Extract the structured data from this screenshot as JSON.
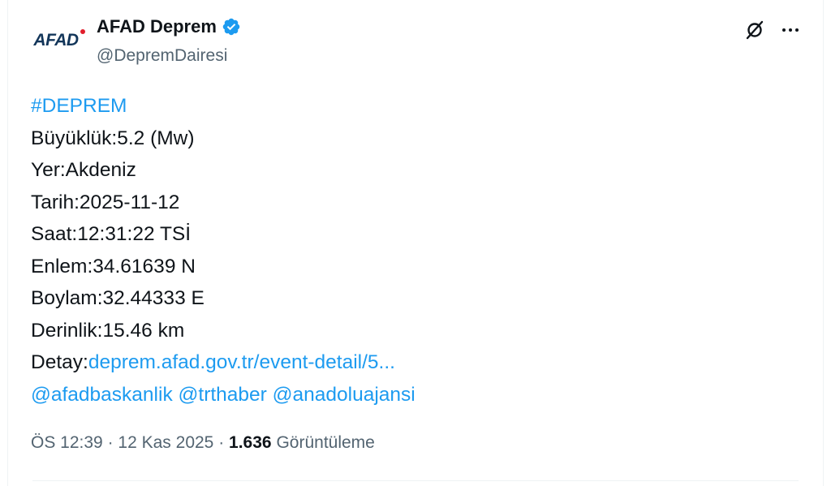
{
  "author": {
    "logo_text": "AFAD",
    "display_name": "AFAD Deprem",
    "handle": "@DepremDairesi",
    "verified_icon": "verified-badge-icon",
    "brand_colors": {
      "logo_blue": "#13365a",
      "logo_red": "#e11d2b",
      "verified_blue": "#1d9bf0"
    }
  },
  "actions": {
    "grok_icon": "grok-icon",
    "more_icon": "more-horizontal-icon",
    "more_label": "···"
  },
  "post": {
    "hashtag": "#DEPREM",
    "lines": [
      "Büyüklük:5.2 (Mw)",
      "Yer:Akdeniz",
      "Tarih:2025-11-12",
      "Saat:12:31:22 TSİ",
      "Enlem:34.61639 N",
      "Boylam:32.44333 E",
      "Derinlik:15.46 km"
    ],
    "detail_label": "Detay:",
    "detail_link": "deprem.afad.gov.tr/event-detail/5...",
    "mentions": [
      "@afadbaskanlik",
      "@trthaber",
      "@anadoluajansi"
    ]
  },
  "meta": {
    "time": "ÖS 12:39",
    "separator": "·",
    "date": "12 Kas 2025",
    "views_count": "1.636",
    "views_label": "Görüntüleme"
  },
  "colors": {
    "text": "#0f1419",
    "secondary": "#536471",
    "link": "#1d9bf0",
    "border": "#eff3f4"
  }
}
